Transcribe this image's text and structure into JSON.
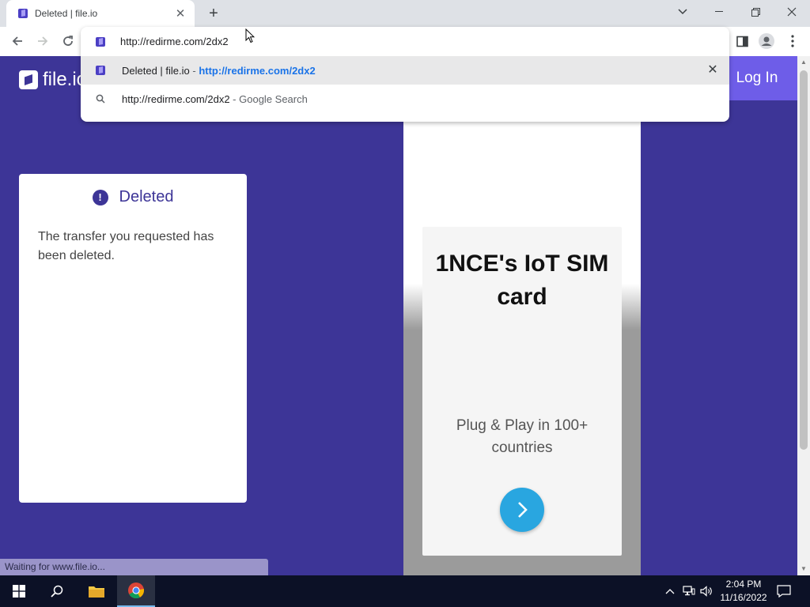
{
  "browser": {
    "tab": {
      "title": "Deleted | file.io"
    },
    "address_bar": {
      "value": "http://redirme.com/2dx2"
    },
    "suggestions": [
      {
        "title": "Deleted | file.io",
        "separator": " - ",
        "url": "http://redirme.com/2dx2"
      },
      {
        "query": "http://redirme.com/2dx2",
        "separator": " - ",
        "engine": "Google Search"
      }
    ],
    "status": "Waiting for www.file.io..."
  },
  "page": {
    "logo_text": "file.io",
    "login_label": "Log In",
    "deleted_card": {
      "title": "Deleted",
      "message": "The transfer you requested has been deleted."
    },
    "ad": {
      "title": "1NCE's IoT SIM card",
      "subtitle": "Plug & Play in 100+ countries"
    }
  },
  "taskbar": {
    "time": "2:04 PM",
    "date": "11/16/2022"
  },
  "colors": {
    "page_background": "#3d3597",
    "login_button": "#6e5de8",
    "cta_button": "#29a6e0",
    "link_blue": "#1a73e8"
  }
}
